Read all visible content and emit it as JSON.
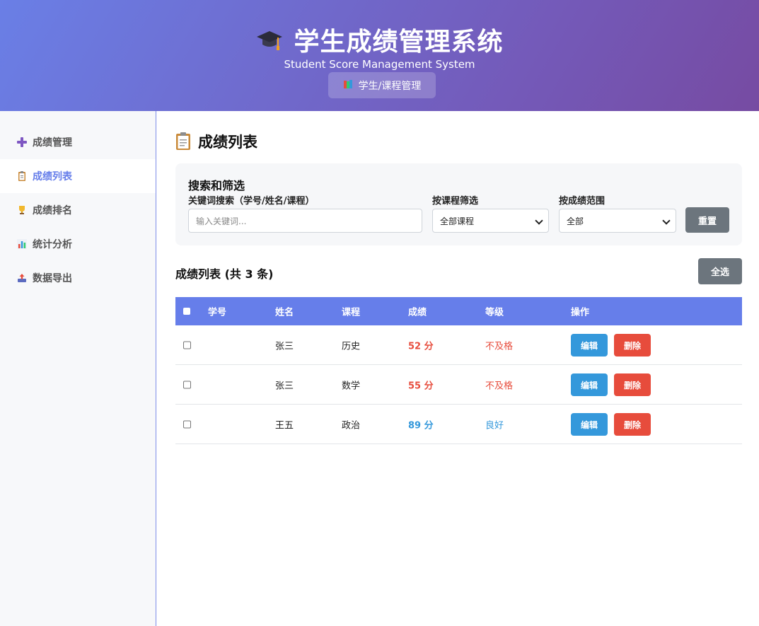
{
  "header": {
    "title": "学生成绩管理系统",
    "subtitle": "Student Score Management System",
    "nav_button": "学生/课程管理"
  },
  "sidebar": {
    "items": [
      {
        "label": "成绩管理",
        "icon": "plus-icon",
        "active": false
      },
      {
        "label": "成绩列表",
        "icon": "clipboard-icon",
        "active": true
      },
      {
        "label": "成绩排名",
        "icon": "trophy-icon",
        "active": false
      },
      {
        "label": "统计分析",
        "icon": "bar-chart-icon",
        "active": false
      },
      {
        "label": "数据导出",
        "icon": "export-tray-icon",
        "active": false
      }
    ]
  },
  "main": {
    "page_title": "成绩列表",
    "filter": {
      "title": "搜索和筛选",
      "keyword_label": "关键词搜索（学号/姓名/课程）",
      "keyword_placeholder": "输入关键词...",
      "course_label": "按课程筛选",
      "course_value": "全部课程",
      "range_label": "按成绩范围",
      "range_value": "全部",
      "reset_label": "重置"
    },
    "list_heading": "成绩列表 (共 3 条)",
    "select_all_label": "全选",
    "table": {
      "headers": [
        "学号",
        "姓名",
        "课程",
        "成绩",
        "等级",
        "操作"
      ],
      "rows": [
        {
          "id": "",
          "name": "张三",
          "course": "历史",
          "score": "52 分",
          "grade": "不及格",
          "status": "fail"
        },
        {
          "id": "",
          "name": "张三",
          "course": "数学",
          "score": "55 分",
          "grade": "不及格",
          "status": "fail"
        },
        {
          "id": "",
          "name": "王五",
          "course": "政治",
          "score": "89 分",
          "grade": "良好",
          "status": "good"
        }
      ],
      "edit_label": "编辑",
      "delete_label": "删除"
    }
  },
  "colors": {
    "accent": "#667eea",
    "header_gradient_end": "#764ba2",
    "fail": "#e74c3c",
    "good": "#3498db",
    "gray_button": "#6c757d"
  }
}
